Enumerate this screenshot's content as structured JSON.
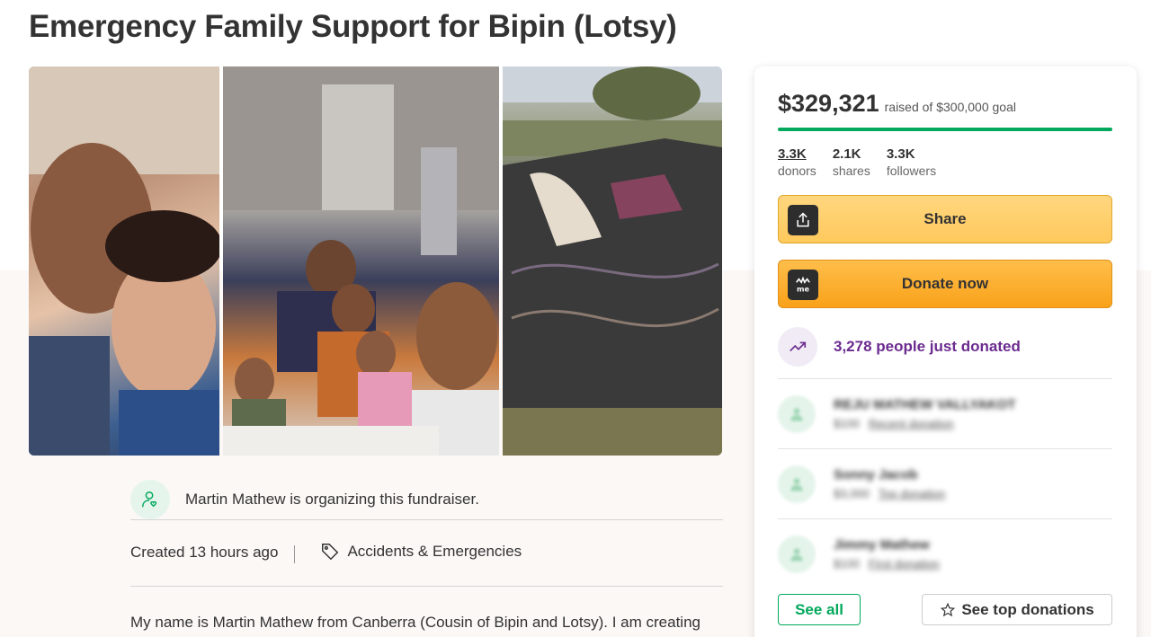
{
  "page": {
    "title": "Emergency Family Support for Bipin (Lotsy)"
  },
  "organizer": {
    "text": "Martin Mathew is organizing this fundraiser."
  },
  "meta": {
    "created": "Created 13 hours ago",
    "category": "Accidents & Emergencies"
  },
  "story": {
    "first_line": "My name is Martin Mathew from Canberra (Cousin of Bipin and Lotsy). I am creating"
  },
  "donation_card": {
    "raised_amount": "$329,321",
    "goal_text": "raised of $300,000 goal",
    "progress_fraction": 1.0,
    "accent_color": "#02a95c",
    "stats": [
      {
        "value": "3.3K",
        "label": "donors"
      },
      {
        "value": "2.1K",
        "label": "shares"
      },
      {
        "value": "3.3K",
        "label": "followers"
      }
    ],
    "share_label": "Share",
    "donate_label": "Donate now",
    "recent_text": "3,278 people just donated",
    "recent_color": "#6b2b8f",
    "donors": [
      {
        "name": "REJU MATHEW VALLYAKOT",
        "amount": "$100",
        "tag": "Recent donation"
      },
      {
        "name": "Sonny Jacob",
        "amount": "$3,000",
        "tag": "Top donation"
      },
      {
        "name": "Jimmy Mathew",
        "amount": "$100",
        "tag": "First donation"
      }
    ],
    "see_all_label": "See all",
    "see_top_label": "See top donations"
  },
  "icons": {
    "organizer": "user-heart-icon",
    "category": "tag-icon",
    "share": "share-upload-icon",
    "donate": "gofundme-logo-icon",
    "trend": "trending-up-icon",
    "star": "star-outline-icon"
  }
}
